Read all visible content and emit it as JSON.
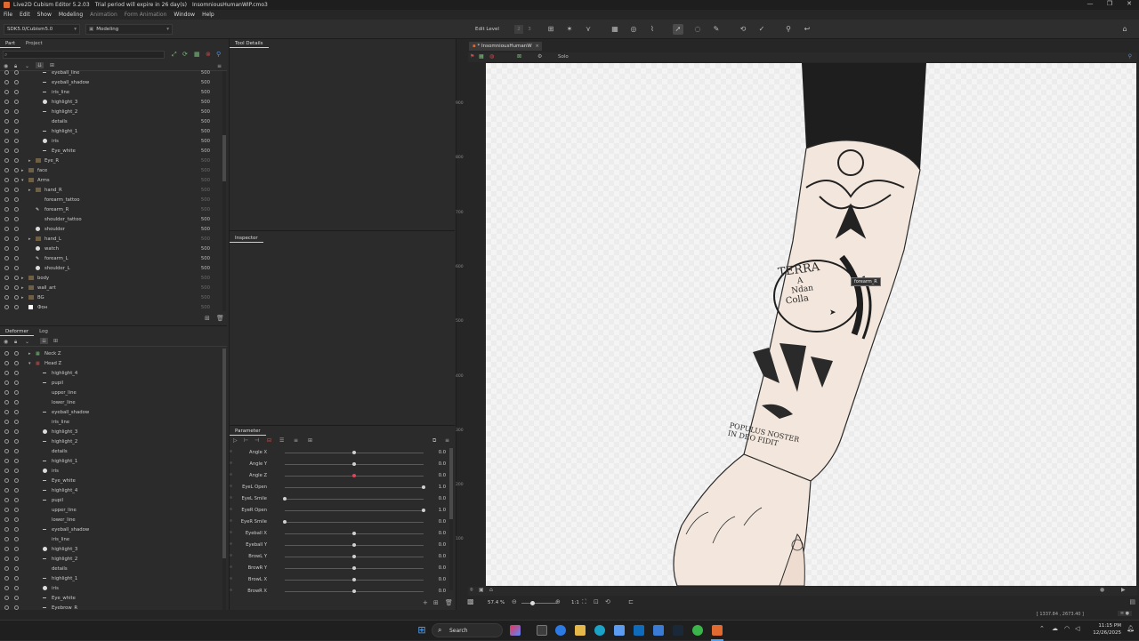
{
  "window": {
    "title": "Live2D Cubism Editor 5.2.03",
    "trial": "Trial period will expire in 26 day(s)",
    "file": "InsomniousHumanWIP.cmo3",
    "controls": [
      "—",
      "❐",
      "✕"
    ]
  },
  "menu": [
    "File",
    "Edit",
    "Show",
    "Modeling",
    "Animation",
    "Form Animation",
    "Window",
    "Help"
  ],
  "toolbar": {
    "sdk": "SDK5.0/Cubism5.0",
    "mode": "Modeling",
    "edit_level_label": "Edit Level",
    "edit_levels": [
      "2",
      "3"
    ]
  },
  "part_panel": {
    "tabs": [
      "Part",
      "Project"
    ],
    "rows": [
      {
        "name": "eyeball_line",
        "num": "500",
        "indent": 2,
        "mark": "dash"
      },
      {
        "name": "eyeball_shadow",
        "num": "500",
        "indent": 2,
        "mark": "dash"
      },
      {
        "name": "iris_line",
        "num": "500",
        "indent": 2,
        "mark": "dash"
      },
      {
        "name": "highlight_3",
        "num": "500",
        "indent": 2,
        "mark": "dot"
      },
      {
        "name": "highlight_2",
        "num": "500",
        "indent": 2,
        "mark": "dash"
      },
      {
        "name": "details",
        "num": "500",
        "indent": 2,
        "mark": "none"
      },
      {
        "name": "highlight_1",
        "num": "500",
        "indent": 2,
        "mark": "dash"
      },
      {
        "name": "iris",
        "num": "500",
        "indent": 2,
        "mark": "dot"
      },
      {
        "name": "Eye_white",
        "num": "500",
        "indent": 2,
        "mark": "dash"
      },
      {
        "name": "Eye_R",
        "num": "500",
        "indent": 1,
        "mark": "folder",
        "dim": true
      },
      {
        "name": "face",
        "num": "500",
        "indent": 0,
        "mark": "folder",
        "dim": true
      },
      {
        "name": "Arms",
        "num": "500",
        "indent": 0,
        "mark": "folder-open",
        "dim": true
      },
      {
        "name": "hand_R",
        "num": "500",
        "indent": 1,
        "mark": "folder",
        "dim": true
      },
      {
        "name": "forearm_tattoo",
        "num": "500",
        "indent": 1,
        "mark": "none",
        "dim": true
      },
      {
        "name": "forearm_R",
        "num": "500",
        "indent": 1,
        "mark": "pen",
        "dim": true
      },
      {
        "name": "shoulder_tattoo",
        "num": "500",
        "indent": 1,
        "mark": "none"
      },
      {
        "name": "shoulder",
        "num": "500",
        "indent": 1,
        "mark": "dot"
      },
      {
        "name": "hand_L",
        "num": "500",
        "indent": 1,
        "mark": "folder",
        "dim": true
      },
      {
        "name": "watch",
        "num": "500",
        "indent": 1,
        "mark": "dot"
      },
      {
        "name": "forearm_L",
        "num": "500",
        "indent": 1,
        "mark": "pen"
      },
      {
        "name": "shoulder_L",
        "num": "500",
        "indent": 1,
        "mark": "dot"
      },
      {
        "name": "body",
        "num": "500",
        "indent": 0,
        "mark": "folder",
        "dim": true
      },
      {
        "name": "wall_art",
        "num": "500",
        "indent": 0,
        "mark": "folder",
        "dim": true
      },
      {
        "name": "BG",
        "num": "500",
        "indent": 0,
        "mark": "folder",
        "dim": true
      },
      {
        "name": "Фон",
        "num": "500",
        "indent": 0,
        "mark": "white",
        "dim": true
      }
    ]
  },
  "deformer_panel": {
    "tabs": [
      "Deformer",
      "Log"
    ],
    "rows": [
      {
        "name": "Neck Z",
        "indent": 1,
        "mark": "grid"
      },
      {
        "name": "Head Z",
        "indent": 1,
        "mark": "grid-red"
      },
      {
        "name": "highlight_4",
        "indent": 2,
        "mark": "dash"
      },
      {
        "name": "pupil",
        "indent": 2,
        "mark": "dash"
      },
      {
        "name": "upper_line",
        "indent": 2,
        "mark": "none"
      },
      {
        "name": "lower_line",
        "indent": 2,
        "mark": "none"
      },
      {
        "name": "eyeball_shadow",
        "indent": 2,
        "mark": "dash"
      },
      {
        "name": "iris_line",
        "indent": 2,
        "mark": "none"
      },
      {
        "name": "highlight_3",
        "indent": 2,
        "mark": "dot"
      },
      {
        "name": "highlight_2",
        "indent": 2,
        "mark": "dash"
      },
      {
        "name": "details",
        "indent": 2,
        "mark": "none"
      },
      {
        "name": "highlight_1",
        "indent": 2,
        "mark": "dash"
      },
      {
        "name": "iris",
        "indent": 2,
        "mark": "dot"
      },
      {
        "name": "Eye_white",
        "indent": 2,
        "mark": "dash"
      },
      {
        "name": "highlight_4",
        "indent": 2,
        "mark": "dash"
      },
      {
        "name": "pupil",
        "indent": 2,
        "mark": "dash"
      },
      {
        "name": "upper_line",
        "indent": 2,
        "mark": "none"
      },
      {
        "name": "lower_line",
        "indent": 2,
        "mark": "none"
      },
      {
        "name": "eyeball_shadow",
        "indent": 2,
        "mark": "dash"
      },
      {
        "name": "iris_line",
        "indent": 2,
        "mark": "none"
      },
      {
        "name": "highlight_3",
        "indent": 2,
        "mark": "dot"
      },
      {
        "name": "highlight_2",
        "indent": 2,
        "mark": "dash"
      },
      {
        "name": "details",
        "indent": 2,
        "mark": "none"
      },
      {
        "name": "highlight_1",
        "indent": 2,
        "mark": "dash"
      },
      {
        "name": "iris",
        "indent": 2,
        "mark": "dot"
      },
      {
        "name": "Eye_white",
        "indent": 2,
        "mark": "dash"
      },
      {
        "name": "Eyebrow_R",
        "indent": 2,
        "mark": "dash"
      }
    ]
  },
  "tool_details": {
    "title": "Tool Details"
  },
  "inspector": {
    "title": "Inspector"
  },
  "parameter_panel": {
    "title": "Parameter",
    "params": [
      {
        "label": "Angle X",
        "value": "0.0",
        "pos": 0.5,
        "red": false
      },
      {
        "label": "Angle Y",
        "value": "0.0",
        "pos": 0.5,
        "red": false
      },
      {
        "label": "Angle Z",
        "value": "0.0",
        "pos": 0.5,
        "red": true
      },
      {
        "label": "EyeL Open",
        "value": "1.0",
        "pos": 1.0,
        "red": false
      },
      {
        "label": "EyeL Smile",
        "value": "0.0",
        "pos": 0.0,
        "red": false
      },
      {
        "label": "EyeR Open",
        "value": "1.0",
        "pos": 1.0,
        "red": false
      },
      {
        "label": "EyeR Smile",
        "value": "0.0",
        "pos": 0.0,
        "red": false
      },
      {
        "label": "Eyeball X",
        "value": "0.0",
        "pos": 0.5,
        "red": false
      },
      {
        "label": "Eyeball Y",
        "value": "0.0",
        "pos": 0.5,
        "red": false
      },
      {
        "label": "BrowL Y",
        "value": "0.0",
        "pos": 0.5,
        "red": false
      },
      {
        "label": "BrowR Y",
        "value": "0.0",
        "pos": 0.5,
        "red": false
      },
      {
        "label": "BrowL X",
        "value": "0.0",
        "pos": 0.5,
        "red": false
      },
      {
        "label": "BrowR X",
        "value": "0.0",
        "pos": 0.5,
        "red": false
      }
    ]
  },
  "viewer": {
    "tab": "* InsomniousHumanW",
    "solo": "Solo",
    "ruler": [
      "900",
      "800",
      "700",
      "600",
      "500",
      "400",
      "300",
      "200",
      "100"
    ],
    "tooltip": "forearm_R",
    "zoom": "57.4 %",
    "ratio": "1:1",
    "tattoo_text": [
      "TERRA",
      "A",
      "Ndan",
      "Colla",
      "POPULUS NOSTER",
      "IN DEO FIDIT"
    ]
  },
  "status": {
    "coords": "[ 1337.84 , 2673.40 ]"
  },
  "taskbar": {
    "search": "Search",
    "time": "11:15 PM",
    "date": "12/26/2025"
  }
}
